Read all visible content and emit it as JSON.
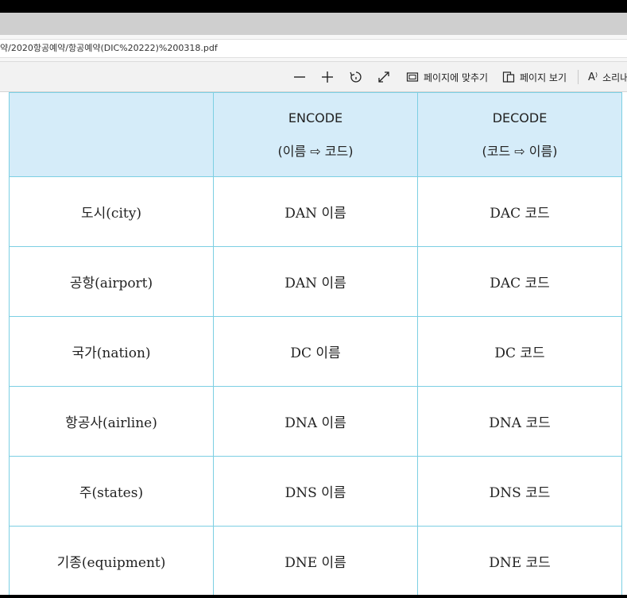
{
  "browser": {
    "url": "약/2020항공예약/항공예약(DIC%20222)%200318.pdf"
  },
  "pdf_toolbar": {
    "zoom_out": "—",
    "zoom_in": "+",
    "fit_page_label": "페이지에 맞추기",
    "page_view_label": "페이지 보기",
    "read_aloud_label": "소리내",
    "read_aloud_glyph": "A⁾"
  },
  "table": {
    "headers": [
      {
        "line1": "",
        "line2": ""
      },
      {
        "line1": "ENCODE",
        "line2": "(이름 ⇨ 코드)"
      },
      {
        "line1": "DECODE",
        "line2": "(코드 ⇨ 이름)"
      }
    ],
    "rows": [
      {
        "name": "도시(city)",
        "encode": "DAN 이름",
        "decode": "DAC 코드"
      },
      {
        "name": "공항(airport)",
        "encode": "DAN 이름",
        "decode": "DAC 코드"
      },
      {
        "name": "국가(nation)",
        "encode": "DC 이름",
        "decode": "DC 코드"
      },
      {
        "name": "항공사(airline)",
        "encode": "DNA 이름",
        "decode": "DNA 코드"
      },
      {
        "name": "주(states)",
        "encode": "DNS 이름",
        "decode": "DNS 코드"
      },
      {
        "name": "기종(equipment)",
        "encode": "DNE 이름",
        "decode": "DNE 코드"
      }
    ]
  },
  "colors": {
    "header_bg": "#d5ecf9",
    "grid_line": "#7ccfe3",
    "toolbar_bg": "#f2f2f2"
  }
}
